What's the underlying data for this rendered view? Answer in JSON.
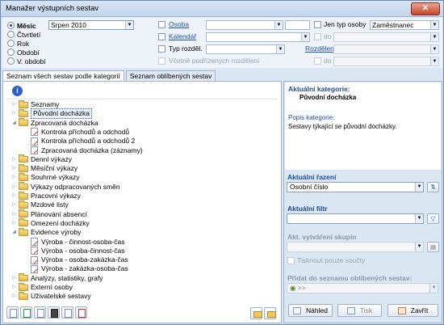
{
  "window": {
    "title": "Manažer výstupních sestav",
    "close_label": "✕"
  },
  "period": {
    "options": [
      "Měsíc",
      "Čtvrtletí",
      "Rok",
      "Období",
      "V. období"
    ],
    "selected_index": 0,
    "select_value": "Srpen 2010"
  },
  "filters": {
    "osoba_label": "Osoba",
    "kalendar_label": "Kalendář",
    "typ_rozdel_label": "Typ rozděl.",
    "vcetne_label": "Včetně podřízených rozdělení",
    "jen_typ_osoby_label": "Jen typ osoby",
    "typ_osoby_value": "Zaměstnanec",
    "do_label_1": "do",
    "do_label_2": "do",
    "rozdeleni_label": "Rozdělení"
  },
  "tabs": [
    {
      "label": "Seznam všech sestav podle kategorií",
      "active": true
    },
    {
      "label": "Seznam oblíbených sestav",
      "active": false
    }
  ],
  "info_icon": "i",
  "tree": [
    {
      "label": "Seznamy",
      "type": "folder",
      "level": 0,
      "expander": "▷"
    },
    {
      "label": "Původní docházka",
      "type": "folder",
      "level": 0,
      "expander": "▷",
      "selected": true
    },
    {
      "label": "Zpracovaná docházka",
      "type": "folder",
      "level": 0,
      "expander": "◢"
    },
    {
      "label": "Kontrola příchodů a odchodů",
      "type": "doc",
      "level": 1
    },
    {
      "label": "Kontrola příchodů a odchodů 2",
      "type": "doc",
      "level": 1
    },
    {
      "label": "Zpracovaná docházka (záznamy)",
      "type": "doc",
      "level": 1
    },
    {
      "label": "Denní výkazy",
      "type": "folder",
      "level": 0,
      "expander": "▷"
    },
    {
      "label": "Měsíční výkazy",
      "type": "folder",
      "level": 0,
      "expander": "▷"
    },
    {
      "label": "Souhrné výkazy",
      "type": "folder",
      "level": 0,
      "expander": "▷"
    },
    {
      "label": "Výkazy odpracovaných směn",
      "type": "folder",
      "level": 0,
      "expander": "▷"
    },
    {
      "label": "Pracovní výkazy",
      "type": "folder",
      "level": 0,
      "expander": "▷"
    },
    {
      "label": "Mzdové listy",
      "type": "folder",
      "level": 0,
      "expander": "▷"
    },
    {
      "label": "Plánování absencí",
      "type": "folder",
      "level": 0,
      "expander": "▷"
    },
    {
      "label": "Omezení docházky",
      "type": "folder",
      "level": 0,
      "expander": "▷"
    },
    {
      "label": "Evidence výroby",
      "type": "folder",
      "level": 0,
      "expander": "◢"
    },
    {
      "label": "Výroba - činnost-osoba-čas",
      "type": "doc",
      "level": 1
    },
    {
      "label": "Výroba - osoba-činnost-čas",
      "type": "doc",
      "level": 1
    },
    {
      "label": "Výroba - osoba-zakázka-čas",
      "type": "doc",
      "level": 1
    },
    {
      "label": "Výroba - zakázka-osoba-čas",
      "type": "doc",
      "level": 1
    },
    {
      "label": "Analýzy, statistiky, grafy",
      "type": "folder",
      "level": 0,
      "expander": "▷"
    },
    {
      "label": "Externí osoby",
      "type": "folder",
      "level": 0,
      "expander": "▷"
    },
    {
      "label": "Uživatelské sestavy",
      "type": "folder",
      "level": 0,
      "expander": "▷"
    }
  ],
  "right": {
    "aktualni_kategorie_label": "Aktuální kategorie:",
    "aktualni_kategorie_value": "Původní docházka",
    "popis_label": "Popis kategorie:",
    "popis_value": "Sestavy týkající se původní docházky.",
    "razeni_label": "Aktuální řazení",
    "razeni_value": "Osobní číslo",
    "filtr_label": "Aktuální filtr",
    "filtr_value": "",
    "skupin_label": "Akt. vytváření skupin",
    "tisknout_label": "Tisknout pouze součty",
    "oblibene_label": "Přidat do seznamu oblíbených sestav:",
    "oblibene_prefix": ">>"
  },
  "buttons": {
    "nahled": "Náhled",
    "tisk": "Tisk",
    "zavrit": "Zavřít"
  }
}
